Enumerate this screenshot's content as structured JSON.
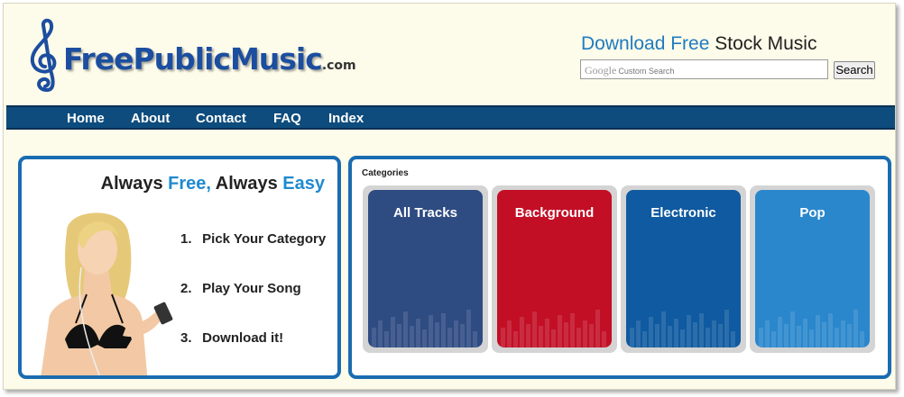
{
  "header": {
    "logo_text": "FreePublicMusic",
    "logo_suffix": ".com",
    "tagline_part1": "Download Free",
    "tagline_part2": "Stock Music",
    "search": {
      "brand": "Google",
      "placeholder": "Custom Search",
      "button_label": "Search"
    }
  },
  "nav": {
    "items": [
      {
        "label": "Home"
      },
      {
        "label": "About"
      },
      {
        "label": "Contact"
      },
      {
        "label": "FAQ"
      },
      {
        "label": "Index"
      }
    ]
  },
  "promo": {
    "title_part1": "Always",
    "title_part2": "Free,",
    "title_part3": "Always",
    "title_part4": "Easy",
    "steps": [
      {
        "num": "1.",
        "text": "Pick Your Category"
      },
      {
        "num": "2.",
        "text": "Play Your Song"
      },
      {
        "num": "3.",
        "text": "Download it!"
      }
    ]
  },
  "categories": {
    "heading": "Categories",
    "items": [
      {
        "label": "All Tracks",
        "color": "#2e4b82"
      },
      {
        "label": "Background",
        "color": "#c20f26"
      },
      {
        "label": "Electronic",
        "color": "#0f5aa0"
      },
      {
        "label": "Pop",
        "color": "#2a87cc"
      }
    ]
  },
  "colors": {
    "accent_blue": "#1f7bc2",
    "nav_bg": "#0e4c7d",
    "panel_border": "#1a6cb1"
  }
}
